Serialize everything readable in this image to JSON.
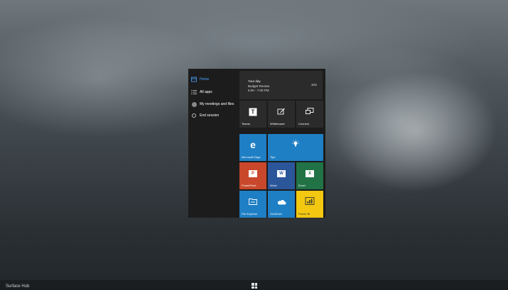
{
  "desktop": {
    "device_label": "Surface Hub"
  },
  "start_menu": {
    "nav": [
      {
        "label": "Home",
        "icon": "home-icon"
      },
      {
        "label": "All apps",
        "icon": "all-apps-icon"
      },
      {
        "label": "My meetings and files",
        "icon": "avatar-icon"
      },
      {
        "label": "End session",
        "icon": "end-session-icon"
      }
    ],
    "calendar": {
      "title": "Your day",
      "event": "Budget Review",
      "time_range": "5:00 - 7:00 PM",
      "right_label": "Join"
    },
    "tiles": [
      {
        "label": "Teams",
        "color": "#2b2b2b",
        "icon": "teams-icon"
      },
      {
        "label": "Whiteboard",
        "color": "#2b2b2b",
        "icon": "whiteboard-icon"
      },
      {
        "label": "Connect",
        "color": "#2b2b2b",
        "icon": "connect-icon"
      },
      {
        "label": "Microsoft Edge",
        "color": "#1f7fc4",
        "icon": "edge-icon"
      },
      {
        "label": "Tips",
        "color": "#1f7fc4",
        "icon": "lightbulb-icon"
      },
      {
        "label": "PowerPoint",
        "color": "#c9482b",
        "icon": "powerpoint-icon"
      },
      {
        "label": "Word",
        "color": "#2b579a",
        "icon": "word-icon"
      },
      {
        "label": "Excel",
        "color": "#217346",
        "icon": "excel-icon"
      },
      {
        "label": "File Explorer",
        "color": "#1f7fc4",
        "icon": "folder-icon"
      },
      {
        "label": "OneDrive",
        "color": "#1f7fc4",
        "icon": "cloud-icon"
      },
      {
        "label": "Power BI",
        "color": "#f2c811",
        "icon": "powerbi-icon"
      }
    ]
  }
}
